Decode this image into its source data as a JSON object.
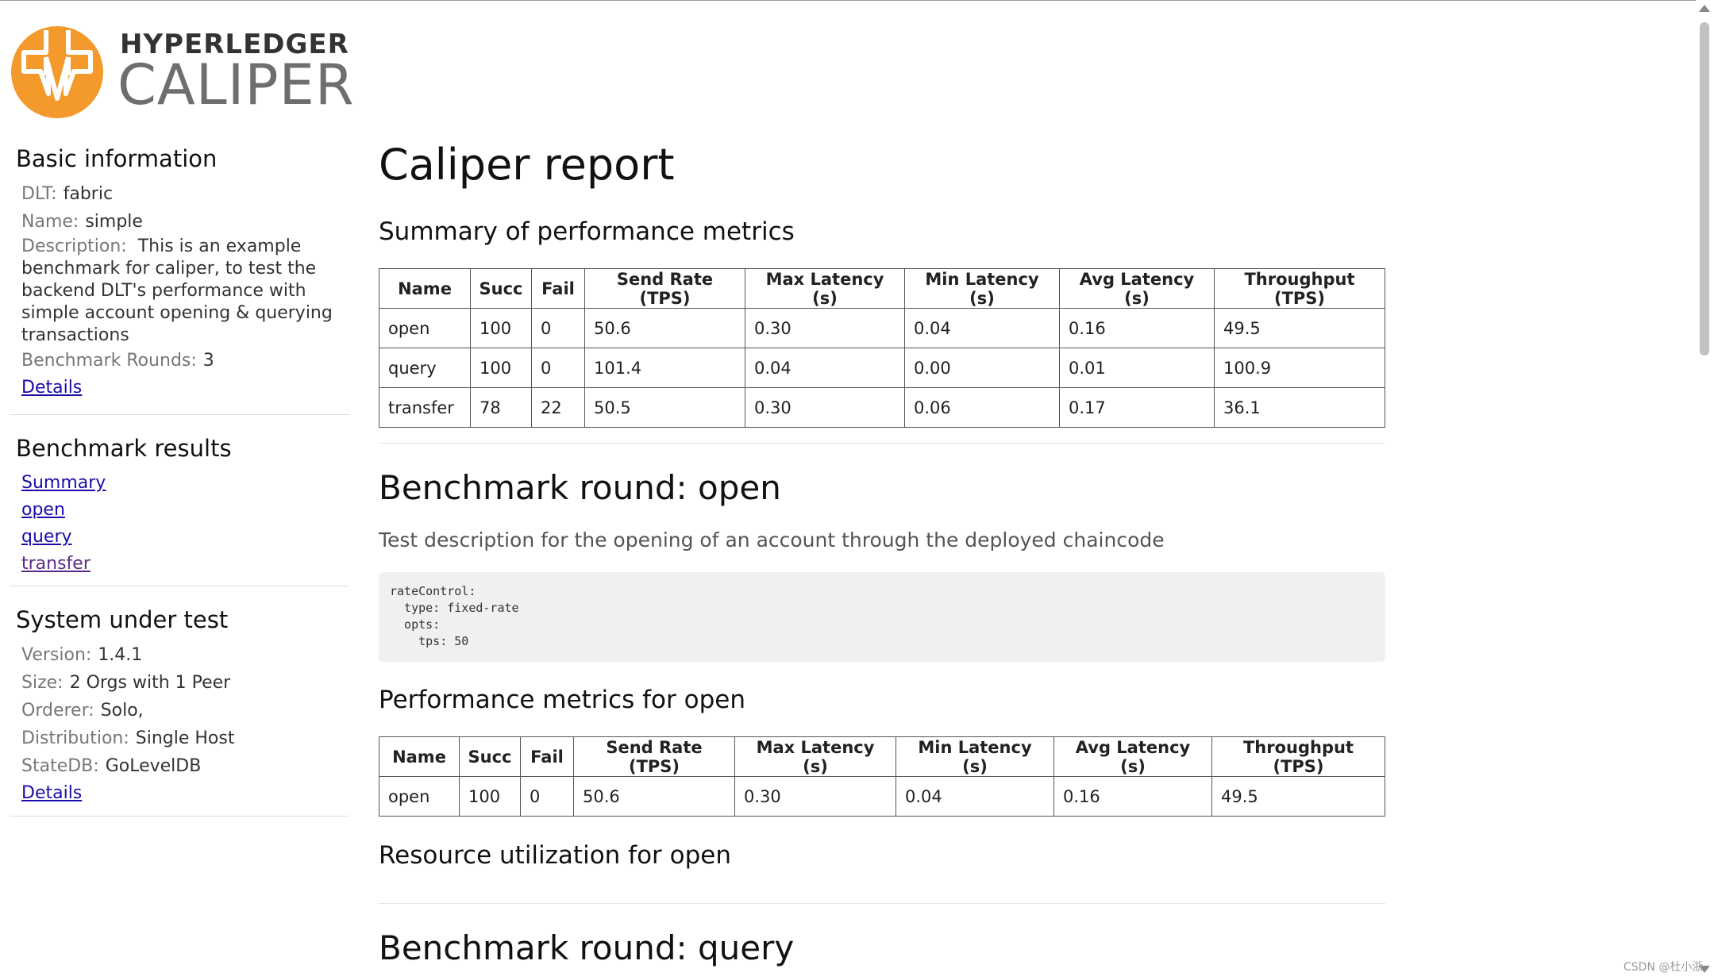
{
  "logo": {
    "line1": "HYPERLEDGER",
    "line2": "CALIPER",
    "color": "#f49a2d"
  },
  "sidebar": {
    "basic": {
      "title": "Basic information",
      "dlt_label": "DLT:",
      "dlt_value": "fabric",
      "name_label": "Name:",
      "name_value": "simple",
      "desc_label": "Description:",
      "desc_value": "This is an example benchmark for caliper, to test the backend DLT's performance with simple account opening & querying transactions",
      "rounds_label": "Benchmark Rounds:",
      "rounds_value": "3",
      "details_link": "Details"
    },
    "results": {
      "title": "Benchmark results",
      "links": [
        "Summary",
        "open",
        "query",
        "transfer"
      ]
    },
    "sut": {
      "title": "System under test",
      "version_label": "Version:",
      "version_value": "1.4.1",
      "size_label": "Size:",
      "size_value": "2 Orgs with 1 Peer",
      "orderer_label": "Orderer:",
      "orderer_value": "Solo,",
      "dist_label": "Distribution:",
      "dist_value": "Single Host",
      "statedb_label": "StateDB:",
      "statedb_value": "GoLevelDB",
      "details_link": "Details"
    }
  },
  "main": {
    "title": "Caliper report",
    "summary_title": "Summary of performance metrics",
    "columns": [
      "Name",
      "Succ",
      "Fail",
      "Send Rate (TPS)",
      "Max Latency (s)",
      "Min Latency (s)",
      "Avg Latency (s)",
      "Throughput (TPS)"
    ],
    "summary_rows": [
      [
        "open",
        "100",
        "0",
        "50.6",
        "0.30",
        "0.04",
        "0.16",
        "49.5"
      ],
      [
        "query",
        "100",
        "0",
        "101.4",
        "0.04",
        "0.00",
        "0.01",
        "100.9"
      ],
      [
        "transfer",
        "78",
        "22",
        "50.5",
        "0.30",
        "0.06",
        "0.17",
        "36.1"
      ]
    ],
    "round_open": {
      "title": "Benchmark round: open",
      "description": "Test description for the opening of an account through the deployed chaincode",
      "config_lines": [
        "rateControl:",
        "  type: fixed-rate",
        "  opts:",
        "    tps: 50"
      ],
      "perf_title": "Performance metrics for open",
      "perf_rows": [
        [
          "open",
          "100",
          "0",
          "50.6",
          "0.30",
          "0.04",
          "0.16",
          "49.5"
        ]
      ],
      "resource_title": "Resource utilization for open"
    },
    "round_query": {
      "title": "Benchmark round: query"
    }
  },
  "watermark": "CSDN @杜小浙"
}
